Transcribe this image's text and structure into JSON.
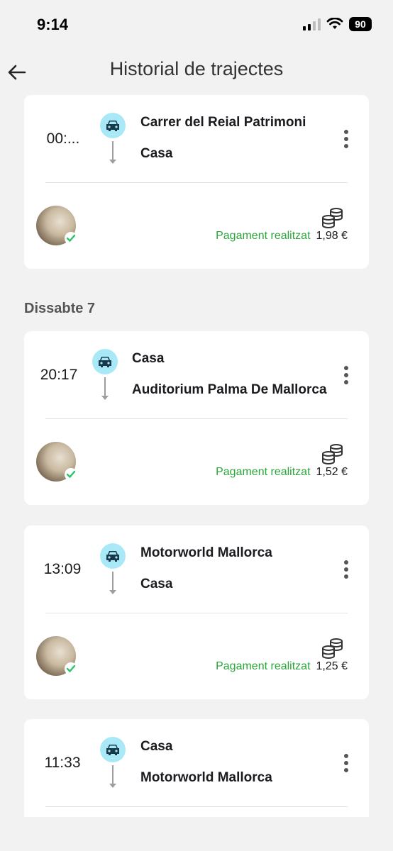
{
  "status_bar": {
    "time": "9:14",
    "battery": "90"
  },
  "header": {
    "title": "Historial de trajectes"
  },
  "sections": [
    {
      "day": "",
      "trips": [
        {
          "time": "00:...",
          "from": "Carrer del Reial Patrimoni",
          "to": "Casa",
          "payment_status": "Pagament realitzat",
          "amount": "1,98 €"
        }
      ]
    },
    {
      "day": "Dissabte 7",
      "trips": [
        {
          "time": "20:17",
          "from": "Casa",
          "to": "Auditorium Palma De Mallorca",
          "payment_status": "Pagament realitzat",
          "amount": "1,52 €"
        },
        {
          "time": "13:09",
          "from": "Motorworld Mallorca",
          "to": "Casa",
          "payment_status": "Pagament realitzat",
          "amount": "1,25 €"
        },
        {
          "time": "11:33",
          "from": "Casa",
          "to": "Motorworld Mallorca",
          "payment_status": "",
          "amount": ""
        }
      ]
    }
  ],
  "colors": {
    "accent_badge": "#a9e8f7",
    "paid_green": "#2aa63a",
    "card_bg": "#ffffff",
    "page_bg": "#f2f2f3"
  },
  "icons": {
    "back": "arrow-left-icon",
    "car": "car-icon",
    "menu": "more-vertical-icon",
    "coins": "coins-icon",
    "check": "check-icon"
  }
}
